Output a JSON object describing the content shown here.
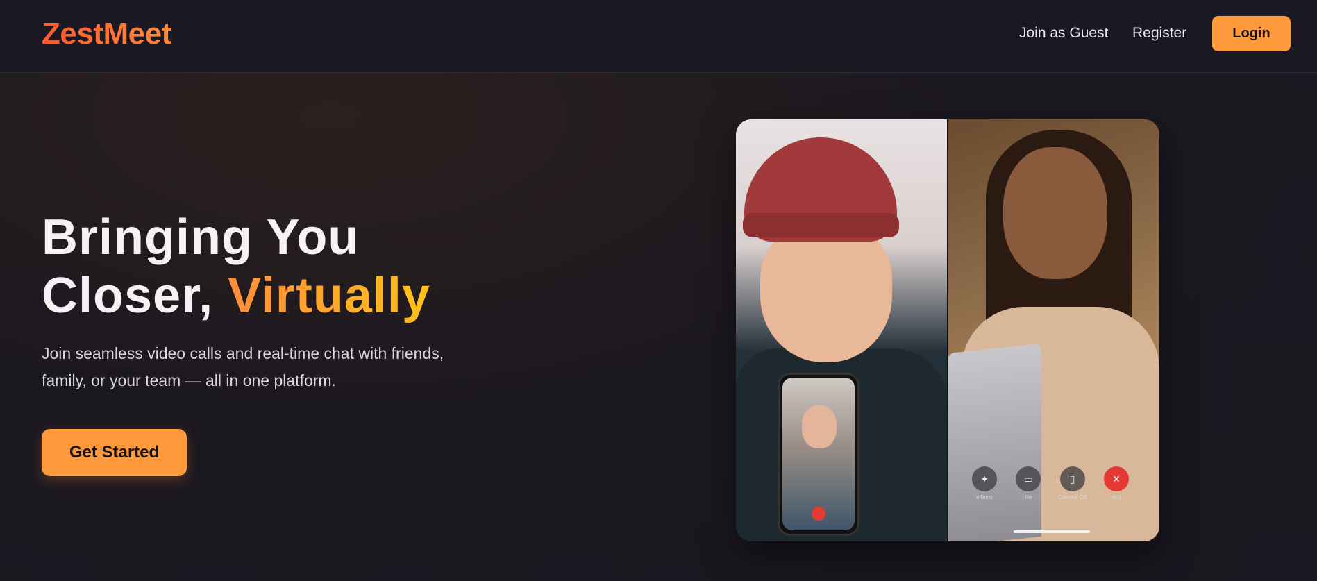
{
  "brand": {
    "logo": "ZestMeet"
  },
  "nav": {
    "guest_label": "Join as Guest",
    "register_label": "Register",
    "login_label": "Login"
  },
  "hero": {
    "title_line1": "Bringing You",
    "title_line2_plain": "Closer, ",
    "title_line2_accent": "Virtually",
    "subtitle": "Join seamless video calls and real-time chat with friends, family, or your team — all in one platform.",
    "cta_label": "Get Started"
  },
  "preview": {
    "controls": [
      {
        "label": "effects",
        "icon": "sparkle-icon"
      },
      {
        "label": "file",
        "icon": "folder-icon"
      },
      {
        "label": "Camera Off",
        "icon": "camera-off-icon"
      },
      {
        "label": "end",
        "icon": "end-call-icon"
      }
    ]
  },
  "colors": {
    "accent": "#ff9a3c",
    "accent_gradient_start": "#ff8c3a",
    "accent_gradient_end": "#ffc21a",
    "logo_color": "#ff6a35",
    "background": "#1c1820",
    "end_call": "#e53935"
  }
}
